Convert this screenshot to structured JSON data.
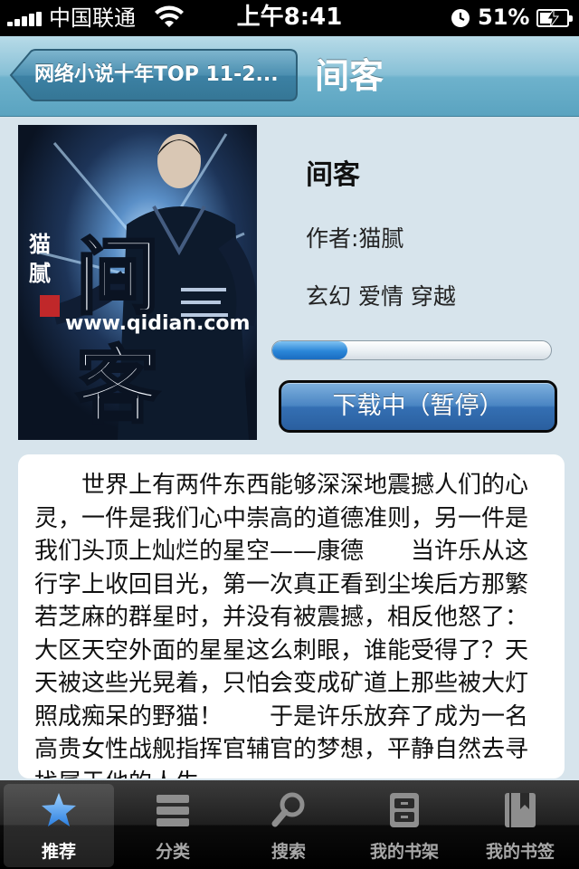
{
  "status_bar": {
    "carrier": "中国联通",
    "time": "上午8:41",
    "battery_percent": "51%",
    "battery_level": 0.51
  },
  "nav": {
    "back_label": "网络小说十年TOP 11-2...",
    "title": "间客"
  },
  "book": {
    "title": "间客",
    "author": "作者:猫腻",
    "tags": "玄幻 爱情 穿越",
    "download_progress": 0.27,
    "download_button_label": "下载中（暂停）",
    "cover": {
      "title_chars": [
        "间",
        "客"
      ],
      "author_chars": [
        "猫",
        "腻"
      ],
      "site": "www.qidian.com"
    }
  },
  "description": "世界上有两件东西能够深深地震撼人们的心灵，一件是我们心中崇高的道德准则，另一件是我们头顶上灿烂的星空——康德　　当许乐从这行字上收回目光，第一次真正看到尘埃后方那繁若芝麻的群星时，并没有被震撼，相反他怒了：大区天空外面的星星这么刺眼，谁能受得了？天天被这些光晃着，只怕会变成矿道上那些被大灯照成痴呆的野猫！　　于是许乐放弃了成为一名高贵女性战舰指挥官辅官的梦想，平静自然去寻找属于他的人生。",
  "tabs": [
    {
      "label": "推荐",
      "icon": "star-icon",
      "active": true
    },
    {
      "label": "分类",
      "icon": "list-icon",
      "active": false
    },
    {
      "label": "搜索",
      "icon": "search-icon",
      "active": false
    },
    {
      "label": "我的书架",
      "icon": "bookshelf-icon",
      "active": false
    },
    {
      "label": "我的书签",
      "icon": "bookmark-icon",
      "active": false
    }
  ],
  "colors": {
    "nav_bar": "#7dbbd3",
    "background": "#d7e4ec",
    "progress_fill": "#2a86d8",
    "button": "#3a74b6",
    "tab_active_icon": "#3d8ee8"
  }
}
